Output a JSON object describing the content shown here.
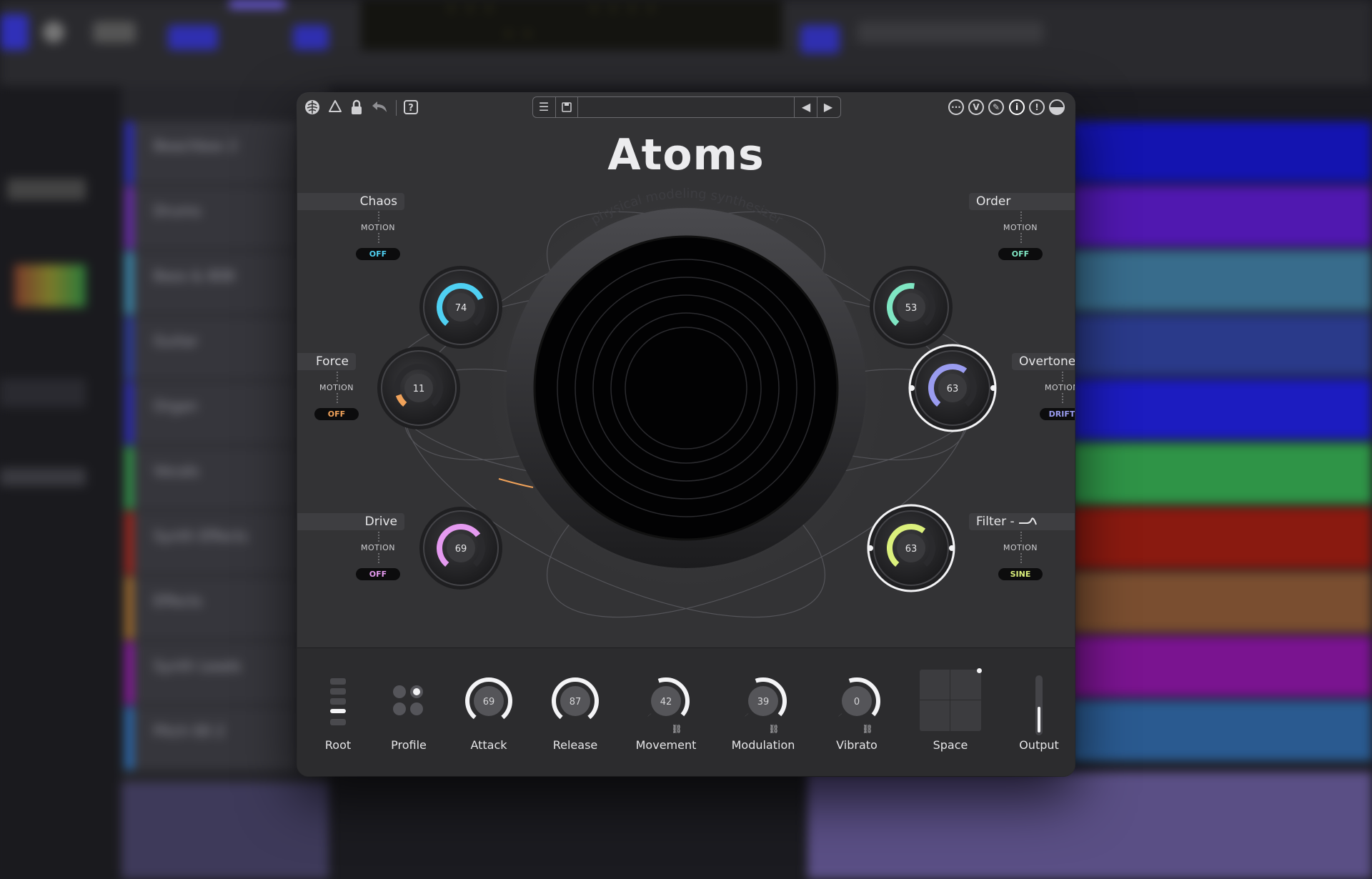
{
  "plugin": {
    "title": "Atoms",
    "subtitle": "physical modeling synthesizer",
    "preset_name": ""
  },
  "colors": {
    "chaos": "#4fd0f2",
    "order": "#7fe6c3",
    "force": "#f0a25a",
    "overtones": "#9a9cf0",
    "drive": "#e59af0",
    "filter": "#dbf07c"
  },
  "icons": {
    "left": [
      "brain-icon",
      "recycle-icon",
      "lock-icon",
      "undo-icon",
      "help-icon"
    ],
    "right": [
      "more-icon",
      "v-icon",
      "feather-icon",
      "info-icon",
      "warning-icon",
      "contrast-icon"
    ]
  },
  "macros": {
    "chaos": {
      "label": "Chaos",
      "value": "74",
      "level": 0.74,
      "motion_label": "MOTION",
      "motion_mode": "OFF"
    },
    "order": {
      "label": "Order",
      "value": "53",
      "level": 0.53,
      "motion_label": "MOTION",
      "motion_mode": "OFF"
    },
    "force": {
      "label": "Force",
      "value": "11",
      "level": 0.11,
      "motion_label": "MOTION",
      "motion_mode": "OFF"
    },
    "overtones": {
      "label": "Overtones",
      "value": "63",
      "level": 0.63,
      "motion_label": "MOTION",
      "motion_mode": "DRIFT"
    },
    "drive": {
      "label": "Drive",
      "value": "69",
      "level": 0.69,
      "motion_label": "MOTION",
      "motion_mode": "OFF"
    },
    "filter": {
      "label": "Filter -",
      "value": "63",
      "level": 0.63,
      "motion_label": "MOTION",
      "motion_mode": "SINE"
    }
  },
  "bottom": {
    "root": {
      "label": "Root"
    },
    "profile": {
      "label": "Profile"
    },
    "attack": {
      "label": "Attack",
      "value": "69"
    },
    "release": {
      "label": "Release",
      "value": "87"
    },
    "movement": {
      "label": "Movement",
      "value": "42"
    },
    "modulation": {
      "label": "Modulation",
      "value": "39"
    },
    "vibrato": {
      "label": "Vibrato",
      "value": "0"
    },
    "space": {
      "label": "Space"
    },
    "output": {
      "label": "Output"
    }
  },
  "daw_tracks": [
    "Beachbox 2",
    "Drums",
    "Bass & 808",
    "Guitar",
    "Organ",
    "Vocals",
    "Synth Effects",
    "Effects",
    "Synth Leads",
    "Pitch 00 2"
  ]
}
